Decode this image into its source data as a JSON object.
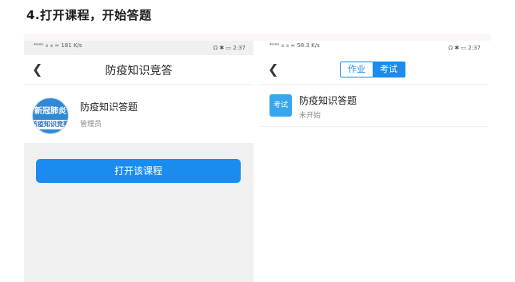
{
  "heading": "4.打开课程，开始答题",
  "left_phone": {
    "status_left": "⁴ᴳ⁴ᴳ ᵢₗₗ ᵢₗₗ ≈ 181 K/s",
    "status_right": "Ω ✱ ▭ 2:37",
    "title": "防疫知识竞答",
    "course": {
      "logo_line1": "新冠肺炎",
      "logo_line2": "防疫知识竞赛",
      "title": "防疫知识答题",
      "subtitle": "管理员"
    },
    "open_button": "打开该课程"
  },
  "right_phone": {
    "status_left": "⁴ᴳ⁴ᴳ ᵢₗₗ ᵢₗₗ ≈ 58.3 K/s",
    "status_right": "Ω ✱ ▭ 2:37",
    "tabs": [
      "作业",
      "考试"
    ],
    "active_tab": "考试",
    "item": {
      "badge": "考试",
      "title": "防疫知识答题",
      "status": "未开始"
    }
  },
  "colors": {
    "accent": "#1a8cf0",
    "badge": "#38a6ee",
    "background_gray": "#f0f0f0"
  }
}
